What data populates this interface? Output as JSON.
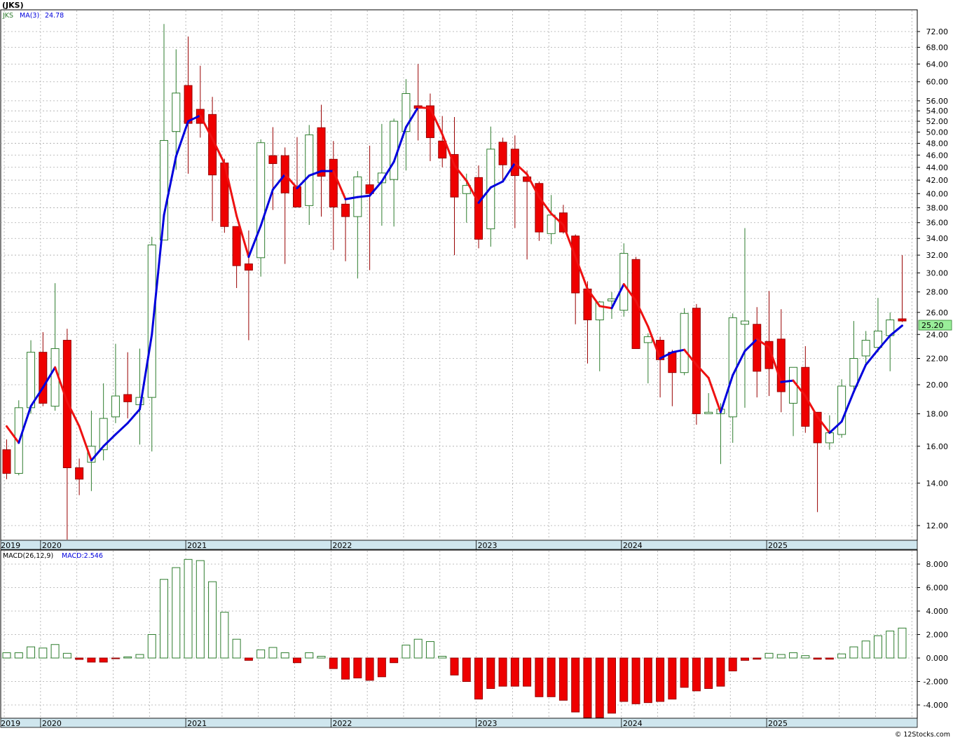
{
  "header": {
    "symbol_title": "(JKS)",
    "legend_symbol": "JKS",
    "legend_ma_label": "MA(3)",
    "legend_ma_value": "24.78",
    "macd_label": "MACD(26,12,9)",
    "macd_value_label": "MACD:2.546",
    "last_price_badge": "25.20",
    "footer_credit": "© 12Stocks.com"
  },
  "colors": {
    "up_candle": "#2e7d2e",
    "down_candle": "#ee0000",
    "ma_up": "#0000dd",
    "ma_down": "#ee1111",
    "axis_band": "#cfe6ee",
    "price_badge": "#99ee99",
    "macd_positive": "#2e7d2e",
    "macd_negative": "#ee0000"
  },
  "chart_data": [
    {
      "type": "candlestick",
      "scale": "log",
      "ylim": [
        11,
        76
      ],
      "y_ticks": [
        "12.00",
        "14.00",
        "16.00",
        "18.00",
        "20.00",
        "22.00",
        "24.00",
        "26.00",
        "28.00",
        "30.00",
        "32.00",
        "34.00",
        "36.00",
        "38.00",
        "40.00",
        "42.00",
        "44.00",
        "46.00",
        "48.00",
        "50.00",
        "52.00",
        "54.00",
        "56.00",
        "60.00",
        "64.00",
        "68.00",
        "72.00"
      ],
      "x_ticks": [
        "2019",
        "2020",
        "2021",
        "2022",
        "2023",
        "2024",
        "2025"
      ],
      "ohlc": [
        [
          15.8,
          16.4,
          14.2,
          14.5
        ],
        [
          14.5,
          18.9,
          14.4,
          18.4
        ],
        [
          18.4,
          23.5,
          18.0,
          22.5
        ],
        [
          22.5,
          24.2,
          18.5,
          18.7
        ],
        [
          18.5,
          28.9,
          18.2,
          22.8
        ],
        [
          23.5,
          24.5,
          11.0,
          14.8
        ],
        [
          14.8,
          15.3,
          13.4,
          14.2
        ],
        [
          15.1,
          18.2,
          13.6,
          16.0
        ],
        [
          15.8,
          20.1,
          15.2,
          17.7
        ],
        [
          17.8,
          23.2,
          17.4,
          19.2
        ],
        [
          19.3,
          22.5,
          17.7,
          18.8
        ],
        [
          18.6,
          22.8,
          16.1,
          19.1
        ],
        [
          19.1,
          34.2,
          15.7,
          33.2
        ],
        [
          33.8,
          74.0,
          33.8,
          48.5
        ],
        [
          50.1,
          67.5,
          43.6,
          57.6
        ],
        [
          59.2,
          70.7,
          43.0,
          51.6
        ],
        [
          54.3,
          63.6,
          49.0,
          51.6
        ],
        [
          53.3,
          56.8,
          36.2,
          42.8
        ],
        [
          44.7,
          45.4,
          34.7,
          35.5
        ],
        [
          35.5,
          35.5,
          28.4,
          30.8
        ],
        [
          31.0,
          35.0,
          23.5,
          30.3
        ],
        [
          31.7,
          48.7,
          29.6,
          48.1
        ],
        [
          45.9,
          50.9,
          37.7,
          44.6
        ],
        [
          45.9,
          47.3,
          31.0,
          40.1
        ],
        [
          41.0,
          49.1,
          38.2,
          38.1
        ],
        [
          38.3,
          51.3,
          35.7,
          49.5
        ],
        [
          50.8,
          55.2,
          36.8,
          42.6
        ],
        [
          45.3,
          48.4,
          32.6,
          38.1
        ],
        [
          38.5,
          39.3,
          31.3,
          36.8
        ],
        [
          36.8,
          43.4,
          29.4,
          42.5
        ],
        [
          41.3,
          47.6,
          30.3,
          40.0
        ],
        [
          41.6,
          51.5,
          35.6,
          43.1
        ],
        [
          42.1,
          52.5,
          35.5,
          52.0
        ],
        [
          50.1,
          60.6,
          43.5,
          57.5
        ],
        [
          55.0,
          64.0,
          48.5,
          54.5
        ],
        [
          55.0,
          57.5,
          45.0,
          49.0
        ],
        [
          48.4,
          53.0,
          44.0,
          45.5
        ],
        [
          46.1,
          52.8,
          32.0,
          39.5
        ],
        [
          40.0,
          43.0,
          36.0,
          41.2
        ],
        [
          42.4,
          44.3,
          32.8,
          33.9
        ],
        [
          35.2,
          51.0,
          33.0,
          47.0
        ],
        [
          48.2,
          49.0,
          42.0,
          44.4
        ],
        [
          47.0,
          49.4,
          35.3,
          42.7
        ],
        [
          42.5,
          43.5,
          31.5,
          41.8
        ],
        [
          41.5,
          41.8,
          33.7,
          34.8
        ],
        [
          34.6,
          39.8,
          33.3,
          37.0
        ],
        [
          37.3,
          38.4,
          34.6,
          34.8
        ],
        [
          34.3,
          34.5,
          24.9,
          27.9
        ],
        [
          28.3,
          29.1,
          21.6,
          25.3
        ],
        [
          25.3,
          27.1,
          21.0,
          27.0
        ],
        [
          27.1,
          28.0,
          25.4,
          27.3
        ],
        [
          26.2,
          33.4,
          25.6,
          32.2
        ],
        [
          31.5,
          31.8,
          22.8,
          22.8
        ],
        [
          23.3,
          24.1,
          20.1,
          23.8
        ],
        [
          23.5,
          23.8,
          19.1,
          21.9
        ],
        [
          22.5,
          22.7,
          18.5,
          20.9
        ],
        [
          20.9,
          26.4,
          20.7,
          25.9
        ],
        [
          26.4,
          26.8,
          17.3,
          18.0
        ],
        [
          18.0,
          19.4,
          18.0,
          18.1
        ],
        [
          18.0,
          18.7,
          15.0,
          18.3
        ],
        [
          17.8,
          25.9,
          16.2,
          25.5
        ],
        [
          24.9,
          35.3,
          18.4,
          25.2
        ],
        [
          24.9,
          26.5,
          19.1,
          21.0
        ],
        [
          23.4,
          28.1,
          19.2,
          21.2
        ],
        [
          23.6,
          26.3,
          18.1,
          19.5
        ],
        [
          18.7,
          21.3,
          16.6,
          21.3
        ],
        [
          21.3,
          23.0,
          16.8,
          17.2
        ],
        [
          18.1,
          18.1,
          12.6,
          16.2
        ],
        [
          16.2,
          17.9,
          15.8,
          16.8
        ],
        [
          16.7,
          20.4,
          16.5,
          19.9
        ],
        [
          19.9,
          25.2,
          19.6,
          22.0
        ],
        [
          22.2,
          24.3,
          21.6,
          23.5
        ],
        [
          22.9,
          27.4,
          22.5,
          24.3
        ],
        [
          23.9,
          26.0,
          21.0,
          25.3
        ],
        [
          25.4,
          32.0,
          25.1,
          25.2
        ]
      ],
      "ma3": [
        17.2,
        16.2,
        18.5,
        19.8,
        21.3,
        18.8,
        17.2,
        15.2,
        16.0,
        16.7,
        17.4,
        18.3,
        24.0,
        37.0,
        45.8,
        52.0,
        53.1,
        48.8,
        44.6,
        36.9,
        31.8,
        35.6,
        40.6,
        42.9,
        40.8,
        42.7,
        43.4,
        43.4,
        39.2,
        39.5,
        39.7,
        41.8,
        44.9,
        50.9,
        54.7,
        54.5,
        49.6,
        44.3,
        41.9,
        38.7,
        40.9,
        41.8,
        44.7,
        42.9,
        39.5,
        37.2,
        35.7,
        31.8,
        28.3,
        26.6,
        26.4,
        28.8,
        27.1,
        24.7,
        22.0,
        22.5,
        22.7,
        21.5,
        20.5,
        18.1,
        20.7,
        22.6,
        23.6,
        22.9,
        20.2,
        20.3,
        19.2,
        17.8,
        16.8,
        17.5,
        19.5,
        21.5,
        22.7,
        23.9,
        24.78
      ],
      "ma_color_segments": "blue when rising, red when falling"
    },
    {
      "type": "bar",
      "ylim": [
        -5,
        9
      ],
      "y_ticks": [
        "8.000",
        "6.000",
        "4.000",
        "2.000",
        "0.000",
        "-2.000",
        "-4.000"
      ],
      "x_ticks": [
        "2019",
        "2020",
        "2021",
        "2022",
        "2023",
        "2024",
        "2025"
      ],
      "values": [
        0.45,
        0.45,
        0.95,
        0.85,
        1.15,
        0.4,
        -0.12,
        -0.35,
        -0.35,
        -0.05,
        0.1,
        0.3,
        2.0,
        6.7,
        7.7,
        8.4,
        8.3,
        6.5,
        3.9,
        1.6,
        -0.2,
        0.7,
        0.9,
        0.45,
        -0.4,
        0.45,
        0.15,
        -0.9,
        -1.8,
        -1.7,
        -1.9,
        -1.6,
        -0.4,
        1.1,
        1.6,
        1.4,
        0.15,
        -1.45,
        -2.0,
        -3.5,
        -2.6,
        -2.4,
        -2.4,
        -2.4,
        -3.3,
        -3.3,
        -3.6,
        -4.6,
        -5.1,
        -5.1,
        -4.7,
        -3.7,
        -3.9,
        -3.8,
        -3.7,
        -3.5,
        -2.5,
        -2.8,
        -2.6,
        -2.4,
        -1.1,
        -0.2,
        -0.1,
        0.4,
        0.3,
        0.45,
        0.2,
        -0.1,
        -0.1,
        0.35,
        0.95,
        1.45,
        1.9,
        2.3,
        2.55
      ]
    }
  ]
}
